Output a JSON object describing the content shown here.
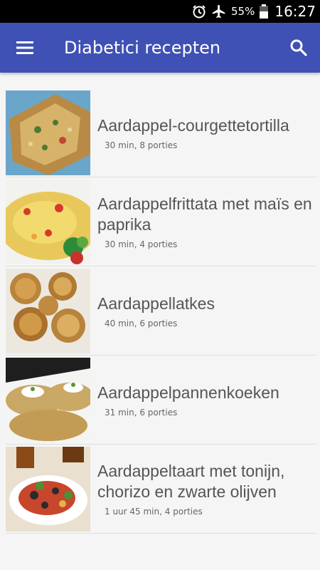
{
  "status_bar": {
    "alarm_icon": "alarm-clock-icon",
    "airplane_icon": "airplane-icon",
    "battery_percent": "55%",
    "battery_icon": "battery-icon",
    "time": "16:27"
  },
  "app_bar": {
    "menu_icon": "hamburger-menu-icon",
    "title": "Diabetici recepten",
    "search_icon": "search-icon",
    "color": "#3f51b5"
  },
  "recipes": [
    {
      "name": "Aardappel-courgettetortilla",
      "meta": "30 min, 8 porties"
    },
    {
      "name": "Aardappelfrittata met maïs en paprika",
      "meta": "30 min, 4 porties"
    },
    {
      "name": "Aardappellatkes",
      "meta": "40 min, 6 porties"
    },
    {
      "name": "Aardappelpannenkoeken",
      "meta": "31 min, 6 porties"
    },
    {
      "name": "Aardappeltaart met tonijn, chorizo en zwarte olijven",
      "meta": "1 uur 45 min, 4 porties"
    }
  ]
}
